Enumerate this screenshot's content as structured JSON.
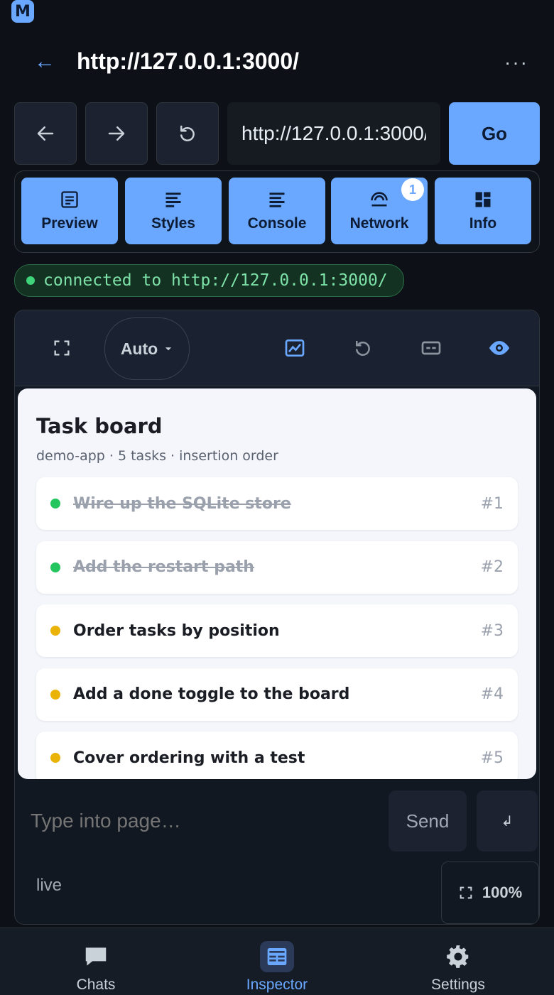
{
  "app": {
    "icon_letter": "M"
  },
  "header": {
    "title": "http://127.0.0.1:3000/",
    "back_glyph": "←",
    "more_glyph": "···"
  },
  "address_bar": {
    "url": "http://127.0.0.1:3000/",
    "go_label": "Go"
  },
  "tabs": [
    {
      "label": "Preview",
      "icon": "document-icon"
    },
    {
      "label": "Styles",
      "icon": "lines-icon"
    },
    {
      "label": "Console",
      "icon": "console-icon"
    },
    {
      "label": "Network",
      "icon": "network-icon",
      "badge": "1"
    },
    {
      "label": "Info",
      "icon": "dashboard-icon"
    }
  ],
  "status": {
    "text": "connected to http://127.0.0.1:3000/",
    "color": "#3fd37a"
  },
  "toolbar": {
    "mode_label": "Auto"
  },
  "preview": {
    "title": "Task board",
    "subtitle": "demo-app · 5 tasks · insertion order",
    "tasks": [
      {
        "text": "Wire up the SQLite store",
        "num": "#1",
        "done": true,
        "color": "#22c55e"
      },
      {
        "text": "Add the restart path",
        "num": "#2",
        "done": true,
        "color": "#22c55e"
      },
      {
        "text": "Order tasks by position",
        "num": "#3",
        "done": false,
        "color": "#eab308"
      },
      {
        "text": "Add a done toggle to the board",
        "num": "#4",
        "done": false,
        "color": "#eab308"
      },
      {
        "text": "Cover ordering with a test",
        "num": "#5",
        "done": false,
        "color": "#eab308"
      }
    ]
  },
  "input": {
    "placeholder": "Type into page…",
    "send_label": "Send",
    "enter_glyph": "↲"
  },
  "footer": {
    "live_label": "live",
    "zoom": "100%"
  },
  "bottom_nav": [
    {
      "label": "Chats",
      "icon": "chat-icon",
      "active": false
    },
    {
      "label": "Inspector",
      "icon": "inspector-icon",
      "active": true
    },
    {
      "label": "Settings",
      "icon": "gear-icon",
      "active": false
    }
  ],
  "colors": {
    "accent": "#6aa8ff",
    "background": "#0d1117"
  }
}
